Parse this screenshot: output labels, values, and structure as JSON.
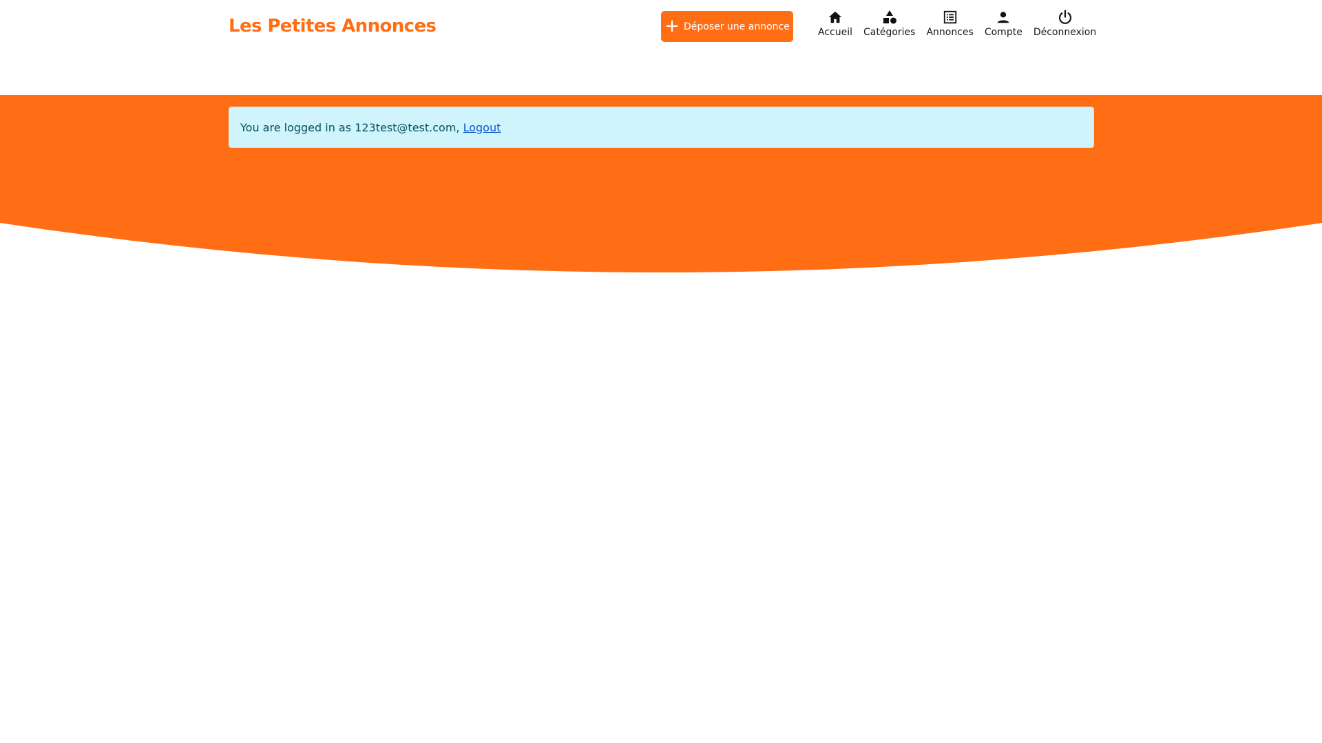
{
  "brand": {
    "title": "Les Petites Annonces",
    "color": "#ff6e14"
  },
  "cta": {
    "label": "Déposer une annonce",
    "icon": "plus-icon"
  },
  "nav": {
    "items": [
      {
        "label": "Accueil",
        "icon": "home-icon"
      },
      {
        "label": "Catégories",
        "icon": "shapes-icon"
      },
      {
        "label": "Annonces",
        "icon": "list-icon"
      },
      {
        "label": "Compte",
        "icon": "user-icon"
      },
      {
        "label": "Déconnexion",
        "icon": "power-icon"
      }
    ]
  },
  "alert": {
    "text": "You are logged in as 123test@test.com,",
    "link_label": "Logout"
  },
  "colors": {
    "accent": "#ff6e14",
    "alert_bg": "#cff4fc",
    "alert_text": "#055160",
    "link": "#0a58ca"
  }
}
